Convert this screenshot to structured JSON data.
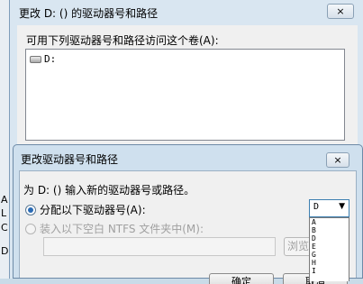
{
  "background_strip": [
    "A",
    "L",
    "C",
    "D"
  ],
  "main_window": {
    "title": "更改 D: () 的驱动器号和路径",
    "close_label": "×",
    "caption": "可用下列驱动器号和路径访问这个卷(A):",
    "drives": [
      "D:"
    ]
  },
  "dialog": {
    "title": "更改驱动器号和路径",
    "close_label": "×",
    "prompt": "为 D: () 输入新的驱动器号或路径。",
    "assign_letter_label": "分配以下驱动器号(A):",
    "mount_folder_label": "装入以下空白 NTFS 文件夹中(M):",
    "browse_label": "浏览(R)...",
    "ok_label": "确定",
    "cancel_label": "取消",
    "selected_letter": "D",
    "letter_options": [
      "A",
      "B",
      "D",
      "E",
      "G",
      "H",
      "I"
    ]
  },
  "colors": {
    "title_bar": "#cfe0ee",
    "client": "#f0f0f0",
    "selected_border": "#3c7fb1"
  }
}
